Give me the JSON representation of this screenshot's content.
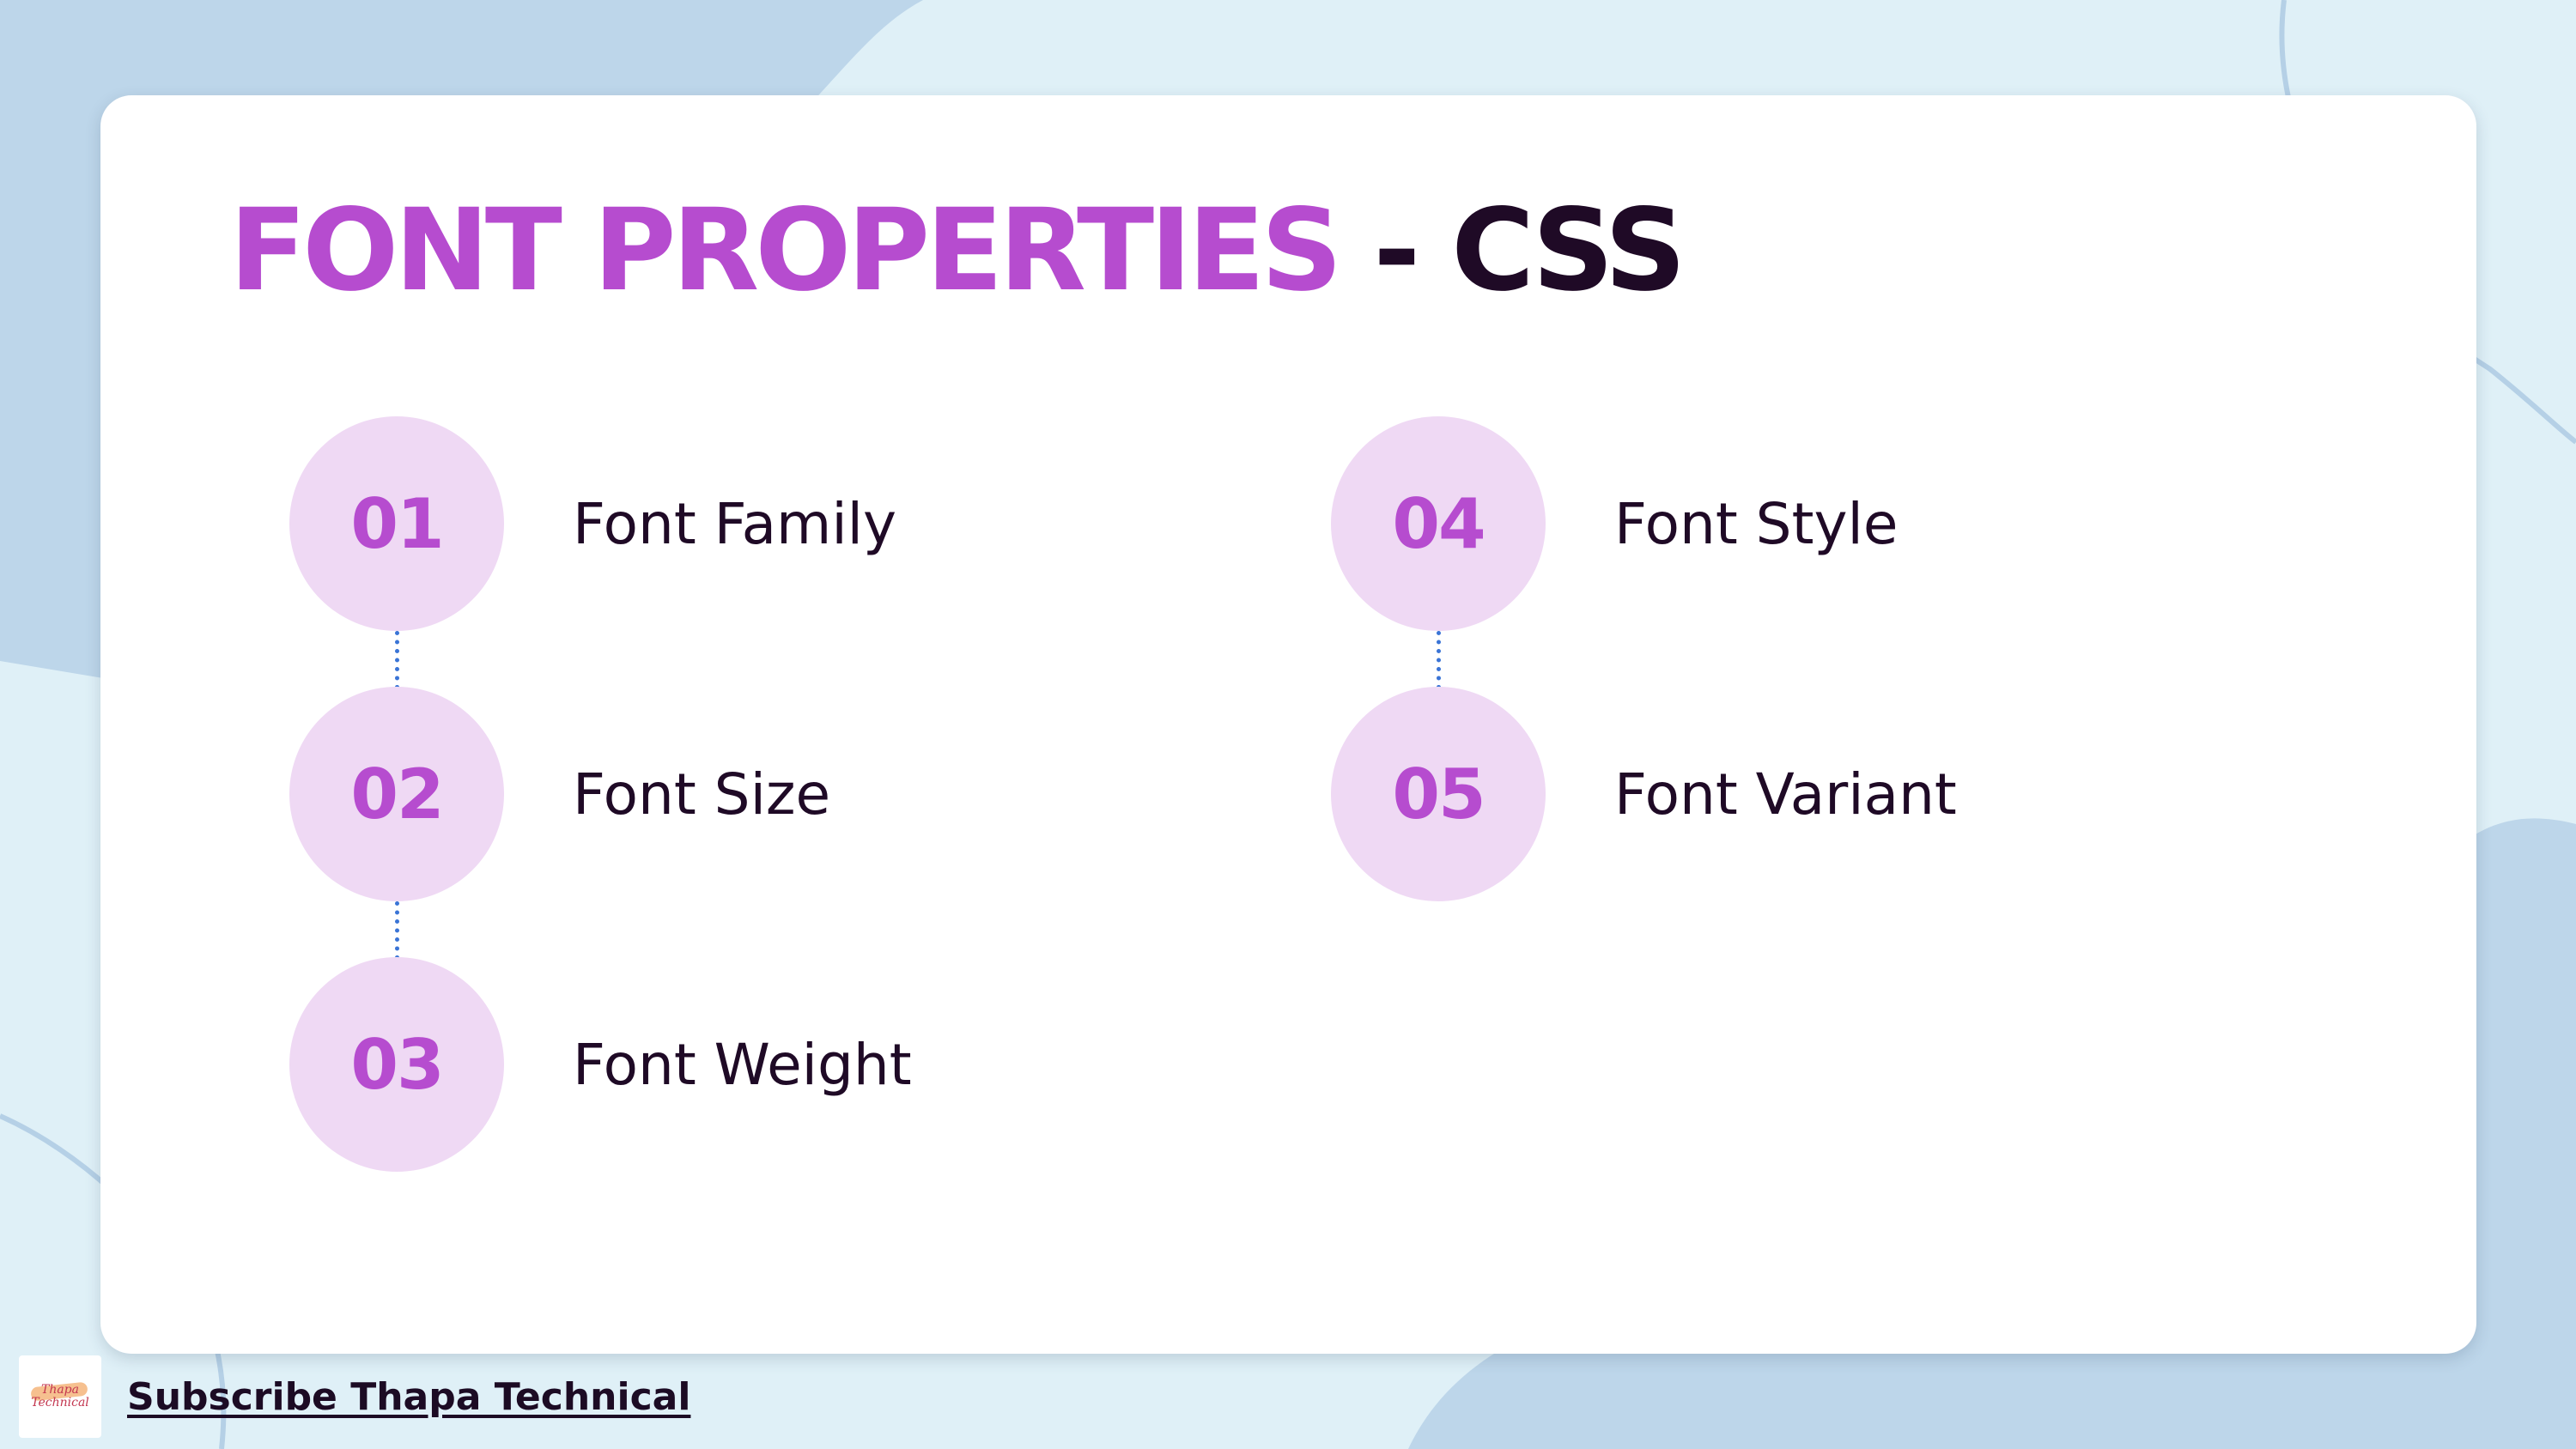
{
  "colors": {
    "accent": "#b64ccf",
    "dark": "#1f0a26",
    "circle": "#efd9f4",
    "background": "#dff0f7",
    "blob": "#bdd6ea"
  },
  "slide": {
    "title_highlight": "FONT PROPERTIES",
    "title_rest": " - CSS"
  },
  "items": [
    {
      "number": "01",
      "label": "Font Family"
    },
    {
      "number": "02",
      "label": "Font Size"
    },
    {
      "number": "03",
      "label": "Font Weight"
    },
    {
      "number": "04",
      "label": "Font Style"
    },
    {
      "number": "05",
      "label": "Font Variant"
    }
  ],
  "footer": {
    "logo_text_line1": "Thapa",
    "logo_text_line2": "Technical",
    "subscribe_text": "Subscribe Thapa Technical"
  }
}
